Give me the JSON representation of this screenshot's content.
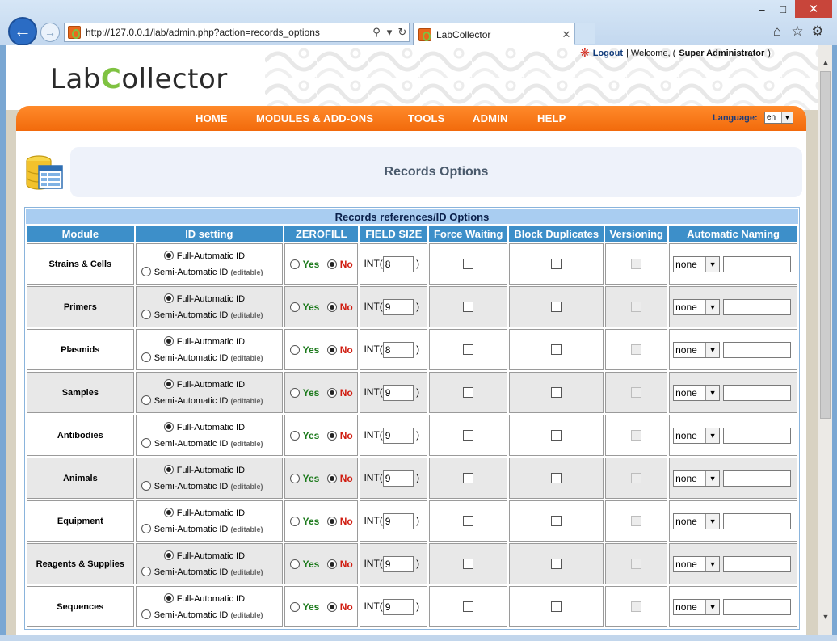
{
  "browser": {
    "url": "http://127.0.0.1/lab/admin.php?action=records_options",
    "tab_title": "LabCollector"
  },
  "header": {
    "logo_left": "Lab",
    "logo_c": "C",
    "logo_right": "ollector",
    "logout_label": "Logout",
    "welcome_text": "| Welcome, (",
    "user_role": "Super Administrator",
    "close_paren": ")"
  },
  "nav": {
    "items": [
      "HOME",
      "MODULES & ADD-ONS",
      "TOOLS",
      "ADMIN",
      "HELP"
    ],
    "language_label": "Language:",
    "language_value": "en"
  },
  "page": {
    "title": "Records Options"
  },
  "table": {
    "caption": "Records references/ID Options",
    "columns": [
      "Module",
      "ID setting",
      "ZEROFILL",
      "FIELD SIZE",
      "Force Waiting",
      "Block Duplicates",
      "Versioning",
      "Automatic Naming"
    ],
    "labels": {
      "full_auto": "Full-Automatic ID",
      "semi_auto": "Semi-Automatic ID",
      "editable": "(editable)",
      "yes": "Yes",
      "no": "No",
      "int_open": "INT(",
      "int_close": ")",
      "naming_default": "none"
    },
    "rows": [
      {
        "module": "Strains & Cells",
        "field_size": "8"
      },
      {
        "module": "Primers",
        "field_size": "9"
      },
      {
        "module": "Plasmids",
        "field_size": "8"
      },
      {
        "module": "Samples",
        "field_size": "9"
      },
      {
        "module": "Antibodies",
        "field_size": "9"
      },
      {
        "module": "Animals",
        "field_size": "9"
      },
      {
        "module": "Equipment",
        "field_size": "9"
      },
      {
        "module": "Reagents & Supplies",
        "field_size": "9"
      },
      {
        "module": "Sequences",
        "field_size": "9"
      }
    ]
  },
  "colors": {
    "nav_orange": "#f26a0c",
    "header_blue": "#3d8fc9",
    "caption_blue": "#a9cdf1",
    "logo_green": "#7fc241"
  }
}
